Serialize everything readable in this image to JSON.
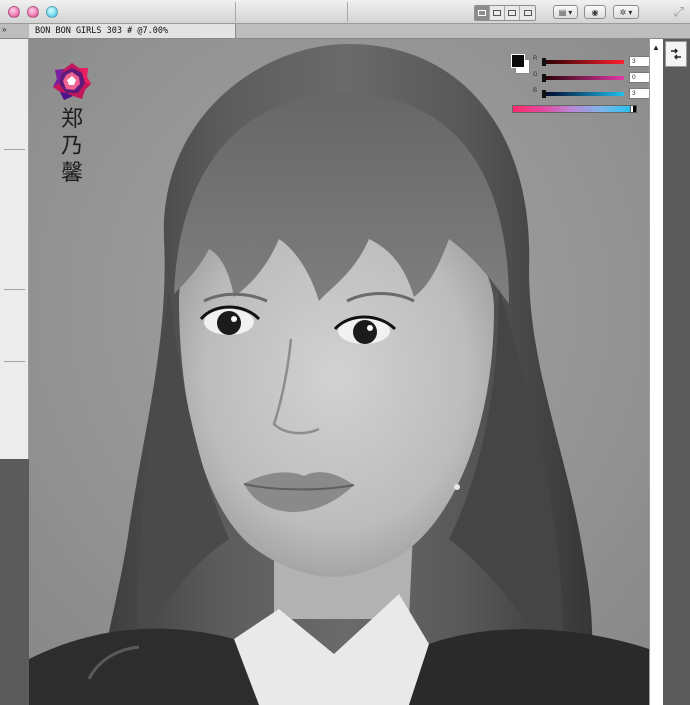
{
  "window": {
    "traffic_lights": [
      "close",
      "minimize",
      "zoom"
    ],
    "toolbar": {
      "view_buttons": [
        "grid-view-icon",
        "list-view-icon",
        "column-view-icon",
        "coverflow-view-icon"
      ],
      "arrange_icon": "arrange-icon",
      "quicklook_icon": "eye-icon",
      "action_icon": "gear-icon",
      "resize_icon": "resize-icon"
    }
  },
  "tab": {
    "collapse_icon": "»",
    "document_title": "BON BON GIRLS 303 # @7.00%"
  },
  "canvas": {
    "name_chars": [
      "郑",
      "乃",
      "馨"
    ],
    "logo_icon": "jewel-logo-icon"
  },
  "color_panel": {
    "sliders": [
      {
        "label": "R",
        "value": "3"
      },
      {
        "label": "G",
        "value": "0"
      },
      {
        "label": "B",
        "value": "3"
      }
    ],
    "colors": {
      "foreground": "#0a0a0a",
      "background": "#ffffff",
      "accent_pink": "#e0408f",
      "accent_cyan": "#34c3e6"
    }
  },
  "scrollbar": {
    "up_arrow": "▲"
  }
}
